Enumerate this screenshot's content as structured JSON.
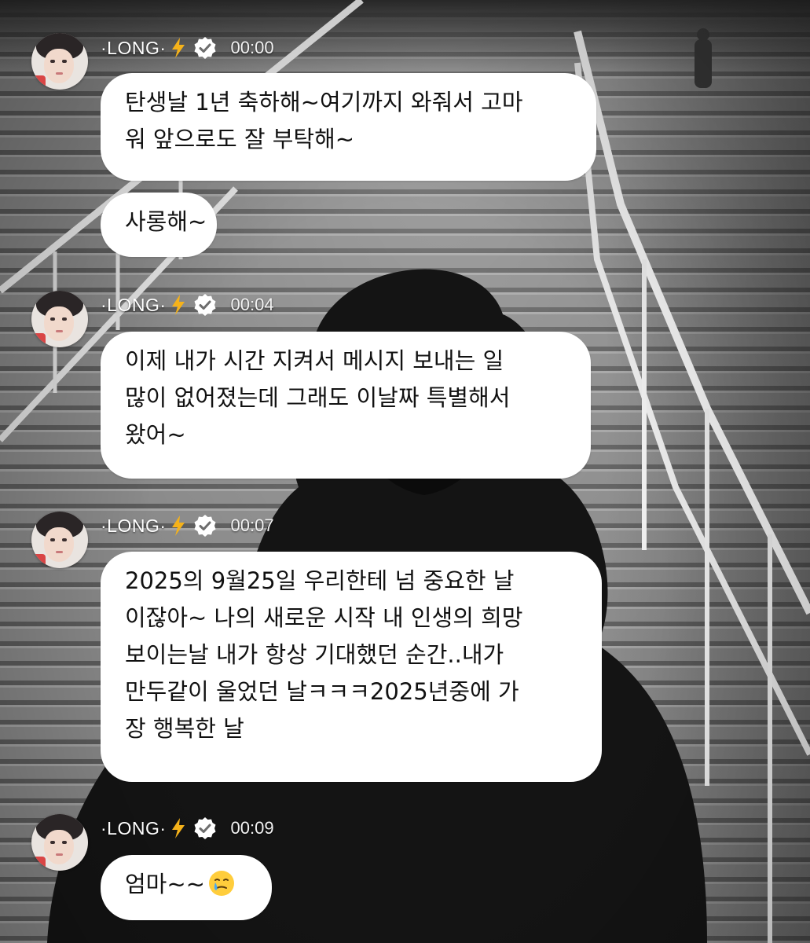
{
  "messages": [
    {
      "sender": "·LONG·",
      "time": "00:00",
      "bubbles": [
        {
          "lines": [
            "탄생날 1년 축하해~여기까지 와줘서 고마",
            "워 앞으로도 잘 부탁해~"
          ]
        },
        {
          "lines": [
            "사롱해~"
          ]
        }
      ]
    },
    {
      "sender": "·LONG·",
      "time": "00:04",
      "bubbles": [
        {
          "lines": [
            "이제 내가 시간 지켜서 메시지 보내는 일",
            "많이 없어졌는데 그래도 이날짜 특별해서",
            "왔어~"
          ]
        }
      ]
    },
    {
      "sender": "·LONG·",
      "time": "00:07",
      "bubbles": [
        {
          "lines": [
            "2025의 9월25일 우리한테 넘 중요한 날",
            "이잖아~ 나의 새로운 시작 내 인생의 희망",
            " 보이는날 내가 항상 기대했던 순간..내가",
            "만두같이 울었던 날ㅋㅋㅋ2025년중에 가",
            "장 행복한 날"
          ]
        }
      ]
    },
    {
      "sender": "·LONG·",
      "time": "00:09",
      "bubbles": [
        {
          "lines": [
            "엄마~~"
          ],
          "emoji": "crying-smile-emoji"
        }
      ]
    }
  ],
  "icons": {
    "sender_emoji": "lightning-bolt-icon",
    "verified": "verified-badge-icon"
  },
  "colors": {
    "bubble": "#ffffff",
    "text": "#111111",
    "bolt": "#f5b21a",
    "badge": "#ffffff"
  }
}
